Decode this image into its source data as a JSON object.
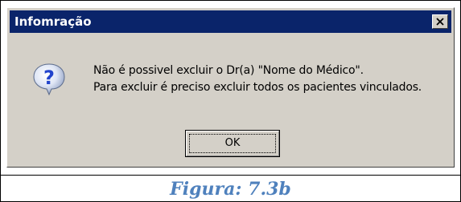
{
  "dialog": {
    "title": "Infomração",
    "close_symbol": "X",
    "icon": "question-icon",
    "message_line1": "Não é possivel excluir o Dr(a) \"Nome do Médico\".",
    "message_line2": "Para excluir é preciso excluir todos os pacientes vinculados.",
    "ok_label": "OK"
  },
  "caption": "Figura: 7.3b",
  "colors": {
    "titlebar": "#0a246a",
    "dialog_face": "#d4d0c8",
    "caption": "#4f81bd",
    "icon_blue": "#2244cc"
  }
}
